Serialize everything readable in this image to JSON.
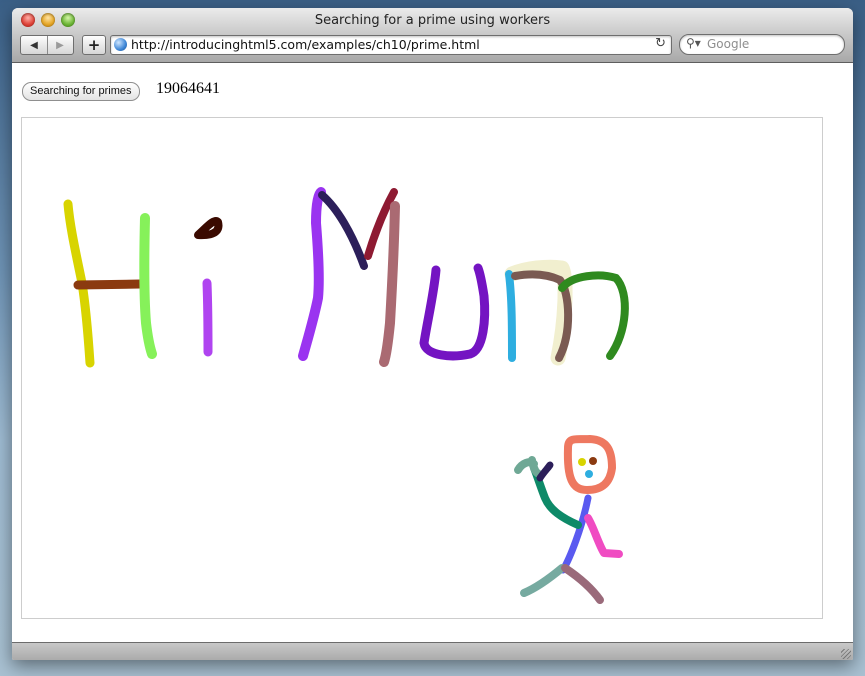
{
  "window": {
    "title": "Searching for a prime using workers"
  },
  "toolbar": {
    "back_icon": "back-arrow-icon",
    "forward_icon": "forward-arrow-icon",
    "add_label": "+",
    "url": "http://introducinghtml5.com/examples/ch10/prime.html",
    "search_placeholder": "Google"
  },
  "content": {
    "button_label": "Searching for primes",
    "prime_value": "19064641",
    "drawing_colors": {
      "H": "#d8d400",
      "H_bar": "#8b3a10",
      "i": "#86f15a",
      "i2": "#b044f0",
      "dot": "#3a0a00",
      "M_left": "#9a34f0",
      "M_diag1": "#2c1f5a",
      "M_diag2": "#8e1a32",
      "M_right": "#aa6a72",
      "u": "#7414c2",
      "m_stem": "#2eaee0",
      "m_arch1": "#7a5a52",
      "m_arch2": "#2f8a1f",
      "m_glow": "#f1efcf",
      "face": "#ee7860",
      "body": "#5a5af0",
      "arm_left": "#0e8a68",
      "hand_left": "#6fa895",
      "arm_right": "#f04cc2",
      "leg_left": "#76aaa0",
      "leg_right": "#9a6a7a"
    }
  }
}
